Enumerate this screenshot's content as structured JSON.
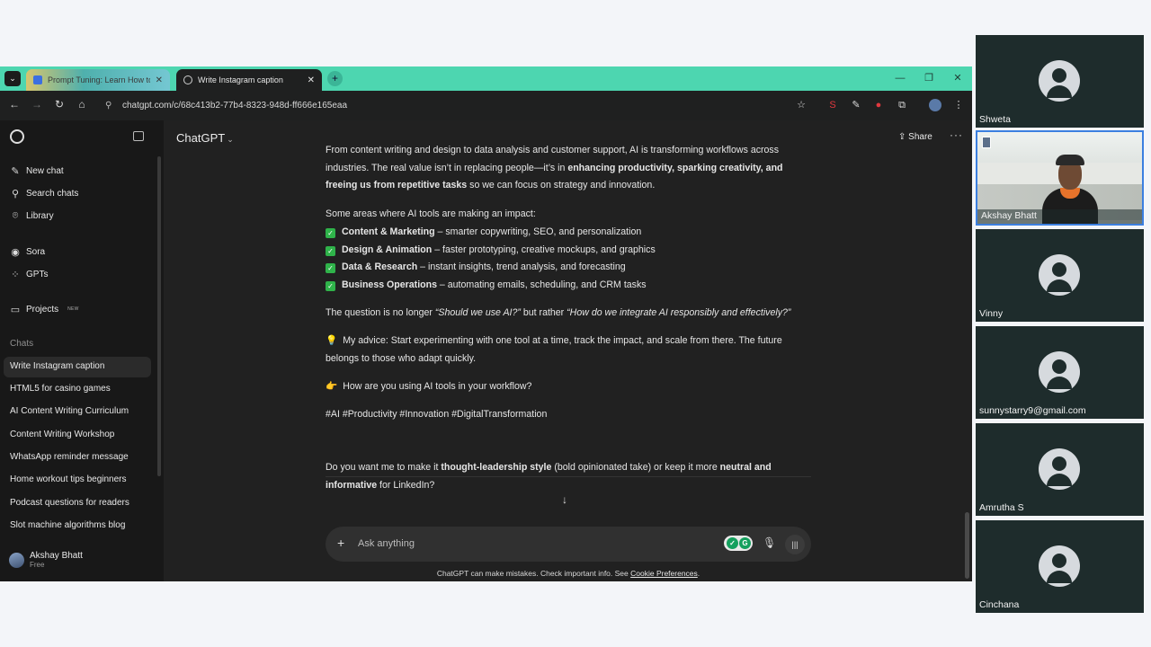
{
  "browser": {
    "tabs": [
      {
        "title": "Prompt Tuning: Learn How to I",
        "active": false
      },
      {
        "title": "Write Instagram caption",
        "active": true
      }
    ],
    "url": "chatgpt.com/c/68c413b2-77b4-8323-948d-ff666e165eaa"
  },
  "app": {
    "model": "ChatGPT",
    "share_label": "Share",
    "sidebar": {
      "nav": [
        {
          "label": "New chat",
          "icon": "edit-icon"
        },
        {
          "label": "Search chats",
          "icon": "search-icon"
        },
        {
          "label": "Library",
          "icon": "library-icon"
        },
        {
          "label": "Sora",
          "icon": "sora-icon"
        },
        {
          "label": "GPTs",
          "icon": "gpts-icon"
        },
        {
          "label": "Projects",
          "icon": "folder-icon",
          "badge": "NEW"
        }
      ],
      "chats_heading": "Chats",
      "chats": [
        "Write Instagram caption",
        "HTML5 for casino games",
        "AI Content Writing Curriculum",
        "Content Writing Workshop",
        "WhatsApp reminder message",
        "Home workout tips beginners",
        "Podcast questions for readers",
        "Slot machine algorithms blog"
      ],
      "user": {
        "name": "Akshay Bhatt",
        "plan": "Free"
      }
    },
    "message": {
      "p1_a": "From content writing and design to data analysis and customer support, AI is transforming workflows across industries. The real value isn’t in replacing people—it’s in ",
      "p1_b": "enhancing productivity, sparking creativity, and freeing us from repetitive tasks",
      "p1_c": " so we can focus on strategy and innovation.",
      "areas_intro": "Some areas where AI tools are making an impact:",
      "areas": [
        {
          "title": "Content & Marketing",
          "desc": " – smarter copywriting, SEO, and personalization"
        },
        {
          "title": "Design & Animation",
          "desc": " – faster prototyping, creative mockups, and graphics"
        },
        {
          "title": "Data & Research",
          "desc": " – instant insights, trend analysis, and forecasting"
        },
        {
          "title": "Business Operations",
          "desc": " – automating emails, scheduling, and CRM tasks"
        }
      ],
      "q_a": "The question is no longer ",
      "q_b": "“Should we use AI?”",
      "q_c": " but rather ",
      "q_d": "“How do we integrate AI responsibly and effectively?”",
      "advice": "My advice: Start experimenting with one tool at a time, track the impact, and scale from there. The future belongs to those who adapt quickly.",
      "question": "How are you using AI tools in your workflow?",
      "hashtags": "#AI #Productivity #Innovation #DigitalTransformation",
      "followup_a": "Do you want me to make it ",
      "followup_b": "thought-leadership style",
      "followup_c": " (bold opinionated take) or keep it more ",
      "followup_d": "neutral and informative",
      "followup_e": " for LinkedIn?"
    },
    "composer": {
      "placeholder": "Ask anything"
    },
    "disclaimer": "ChatGPT can make mistakes. Check important info. See ",
    "disclaimer_link": "Cookie Preferences",
    "disclaimer_end": "."
  },
  "participants": [
    {
      "name": "Shweta",
      "video": false
    },
    {
      "name": "Akshay Bhatt",
      "video": true,
      "active": true
    },
    {
      "name": "Vinny",
      "video": false
    },
    {
      "name": "sunnystarry9@gmail.com",
      "video": false
    },
    {
      "name": "Amrutha S",
      "video": false
    },
    {
      "name": "Cinchana",
      "video": false
    }
  ],
  "colors": {
    "tabbar": "#4dd6b0",
    "app_bg": "#212121",
    "sidebar_bg": "#181818",
    "active_tile_border": "#3b7fe0",
    "check": "#2fb34a"
  }
}
